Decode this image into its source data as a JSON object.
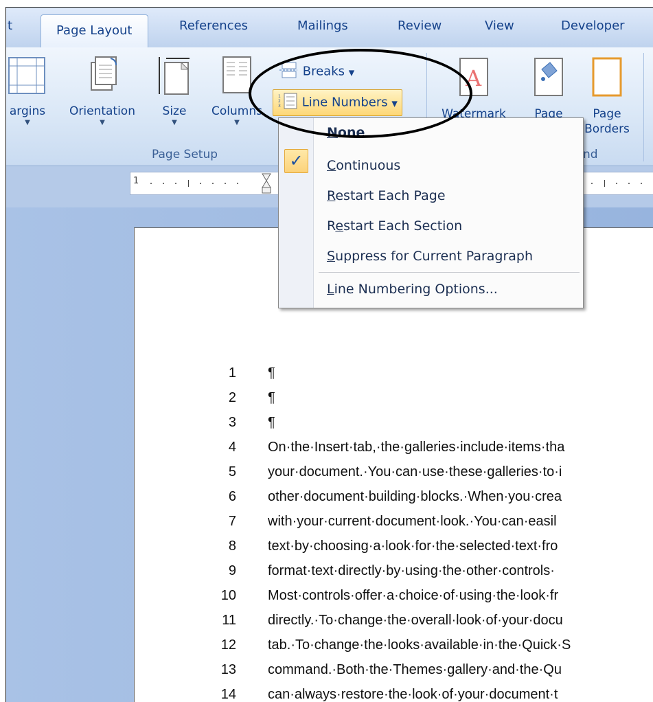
{
  "tabs": [
    {
      "label": "t",
      "active": false
    },
    {
      "label": "Page Layout",
      "active": true
    },
    {
      "label": "References",
      "active": false
    },
    {
      "label": "Mailings",
      "active": false
    },
    {
      "label": "Review",
      "active": false
    },
    {
      "label": "View",
      "active": false
    },
    {
      "label": "Developer",
      "active": false
    }
  ],
  "ribbon": {
    "page_setup": {
      "group_label": "Page Setup",
      "margins": "argins",
      "orientation": "Orientation",
      "size": "Size",
      "columns": "Columns",
      "breaks": "Breaks",
      "line_numbers": "Line Numbers"
    },
    "background": {
      "group_label_partial": "nd",
      "watermark_partial": "Watermark",
      "page_color_partial": "Page",
      "page_borders_line1": "Page",
      "page_borders_line2": "Borders"
    }
  },
  "menu": {
    "items": [
      {
        "label": "None",
        "mnemonic": "N",
        "rest": "one",
        "checked": false
      },
      {
        "label": "Continuous",
        "mnemonic": "C",
        "rest": "ontinuous",
        "checked": true
      },
      {
        "label": "Restart Each Page",
        "mnemonic": "R",
        "rest": "estart Each Page",
        "checked": false
      },
      {
        "label": "Restart Each Section",
        "mnemonic": "e",
        "pre": "R",
        "rest": "start Each Section",
        "checked": false
      },
      {
        "label": "Suppress for Current Paragraph",
        "mnemonic": "S",
        "rest": "uppress for Current Paragraph",
        "checked": false
      },
      {
        "label": "Line Numbering Options...",
        "mnemonic": "L",
        "rest": "ine Numbering Options...",
        "checked": false
      }
    ],
    "check_glyph": "✓"
  },
  "document": {
    "lines": [
      {
        "n": "1",
        "text": "¶"
      },
      {
        "n": "2",
        "text": "¶"
      },
      {
        "n": "3",
        "text": "¶"
      },
      {
        "n": "4",
        "text": "On·the·Insert·tab,·the·galleries·include·items·tha"
      },
      {
        "n": "5",
        "text": "your·document.·You·can·use·these·galleries·to·i"
      },
      {
        "n": "6",
        "text": "other·document·building·blocks.·When·you·crea"
      },
      {
        "n": "7",
        "text": "with·your·current·document·look.·You·can·easil"
      },
      {
        "n": "8",
        "text": "text·by·choosing·a·look·for·the·selected·text·fro"
      },
      {
        "n": "9",
        "text": "format·text·directly·by·using·the·other·controls·"
      },
      {
        "n": "10",
        "text": "Most·controls·offer·a·choice·of·using·the·look·fr"
      },
      {
        "n": "11",
        "text": "directly.·To·change·the·overall·look·of·your·docu"
      },
      {
        "n": "12",
        "text": "tab.·To·change·the·looks·available·in·the·Quick·S"
      },
      {
        "n": "13",
        "text": "command.·Both·the·Themes·gallery·and·the·Qu"
      },
      {
        "n": "14",
        "text": "can·always·restore·the·look·of·your·document·t"
      }
    ]
  },
  "ruler": {
    "label": "1"
  },
  "colors": {
    "ribbon_text": "#15428b",
    "highlight": "#fdd777",
    "doc_bg": "#97b4de"
  }
}
